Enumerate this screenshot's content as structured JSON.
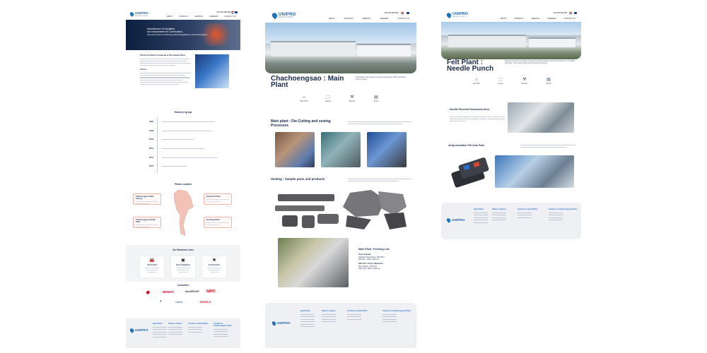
{
  "nav": {
    "brand": "UNIPRO",
    "brand_sub": "MANUFACTURING",
    "phone": "038 580 888 888",
    "menu": [
      "ABOUT",
      "PRODUCT",
      "SERVICE",
      "CAREERS",
      "CONTACT US"
    ]
  },
  "page1": {
    "hero_text": [
      "Manufacturer of insulation",
      "and components for Construction,",
      "Automotive and Air conditioning, Electrical appliances, and Industrial parts."
    ],
    "intro_title": "Chimi Southport Greatoak & Woodward Shar",
    "vision_title": "Vision",
    "history_title": "History of group",
    "history_years": [
      "1987",
      "1993",
      "2002",
      "2011",
      "2014",
      "2015"
    ],
    "plants_title": "Plants Location",
    "plants": [
      "Chachoengsao Main Factory",
      "Samut Pra Plant",
      "Chachoengsao Needle Plant",
      "Bor Bang Plant"
    ],
    "business_title": "Our Business Lines",
    "business": [
      {
        "label": "Automotive",
        "icon": "car-icon",
        "glyph": "🚘"
      },
      {
        "label": "Home Appliance",
        "icon": "appliance-icon",
        "glyph": "▣"
      },
      {
        "label": "Construction",
        "icon": "fan-icon",
        "glyph": "✖"
      }
    ],
    "customers_title": "Customers",
    "customers": [
      {
        "name": "MITSUBISHI",
        "short": "◆",
        "color": "#e60012"
      },
      {
        "name": "DENSO",
        "short": "DENSO",
        "color": "#dc0032"
      },
      {
        "name": "ituGROUP",
        "short": "itsuGROUP",
        "color": "#333333"
      },
      {
        "name": "NEDO",
        "short": "NDIO",
        "color": "#e60012"
      },
      {
        "name": "Taoda",
        "short": "◐",
        "color": "#1a4fa0"
      },
      {
        "name": "Carrier",
        "short": "Carrier",
        "color": "#1a4fa0"
      },
      {
        "name": "TACHI-S",
        "short": "TACHI-S",
        "color": "#e60012"
      }
    ]
  },
  "page2": {
    "title": "Chachoengsao : Main Plant",
    "lede": "Fabrication Processes of Home Appliance Parts and Auto Interior Parts",
    "tabs": [
      {
        "label": "Main Plant",
        "icon": "factory-icon",
        "glyph": "⌂"
      },
      {
        "label": "Seating",
        "icon": "seat-icon",
        "glyph": "⬚"
      },
      {
        "label": "Machine",
        "icon": "press-icon",
        "glyph": "⚒"
      },
      {
        "label": "Board",
        "icon": "board-icon",
        "glyph": "▤"
      }
    ],
    "section1": "Main plant : Die-Cutting and sewing Processes",
    "section2": "Seating : Sample parts and products",
    "section3": "Main Plant : Forming Line",
    "spec": {
      "oven_title": "Oven Heater",
      "oven_temp": "Operation Temperature: 150-300 C",
      "oven_belt": "Belt Size : 4790 x 1290 mm",
      "press_title": "200 Tons Press Machine",
      "press_cap": "M/C Capacity : 200 Tons",
      "press_table": "Table Size : 2500 x 1000 mm"
    }
  },
  "page3": {
    "title": "Felt Plant : Needle Punch",
    "lede": "Manufacturing and converting of Needle Punched nonwoven lines and Airlay line for Insulation Felt Parts - Auto Interior Parts and Construction Products",
    "tabs": [
      {
        "label": "Felt Plant",
        "icon": "factory-icon",
        "glyph": "⌂"
      },
      {
        "label": "Needle",
        "icon": "needle-icon",
        "glyph": "⬚"
      },
      {
        "label": "Machine",
        "icon": "press-icon",
        "glyph": "⚒"
      },
      {
        "label": "Board",
        "icon": "board-icon",
        "glyph": "▤"
      }
    ],
    "section1": "Needle Punched Nonwoven lines",
    "section1_body": "Our two current Felt products cover ranged from fabrics, filters, support material, absorbent to high performance automotive, air filtration, high performance sound absorb fabric and more.",
    "section2": "Airlay Insulation Felt Auto Parts"
  },
  "footer": {
    "col_quick": "Quick links",
    "col_plants": "Plants Location",
    "col_head": "Contact us Head Office",
    "col_plant": "Contact us Chachoengsao Plant",
    "quick": [
      "Home",
      "About",
      "Product",
      "Service",
      "Careers",
      "Contact"
    ],
    "plants": [
      "Chachoengsao Main Factory",
      "Chachoengsao Felt Plant",
      "Chachoengsao Needle Plant",
      "Bor Bang Plant"
    ]
  }
}
